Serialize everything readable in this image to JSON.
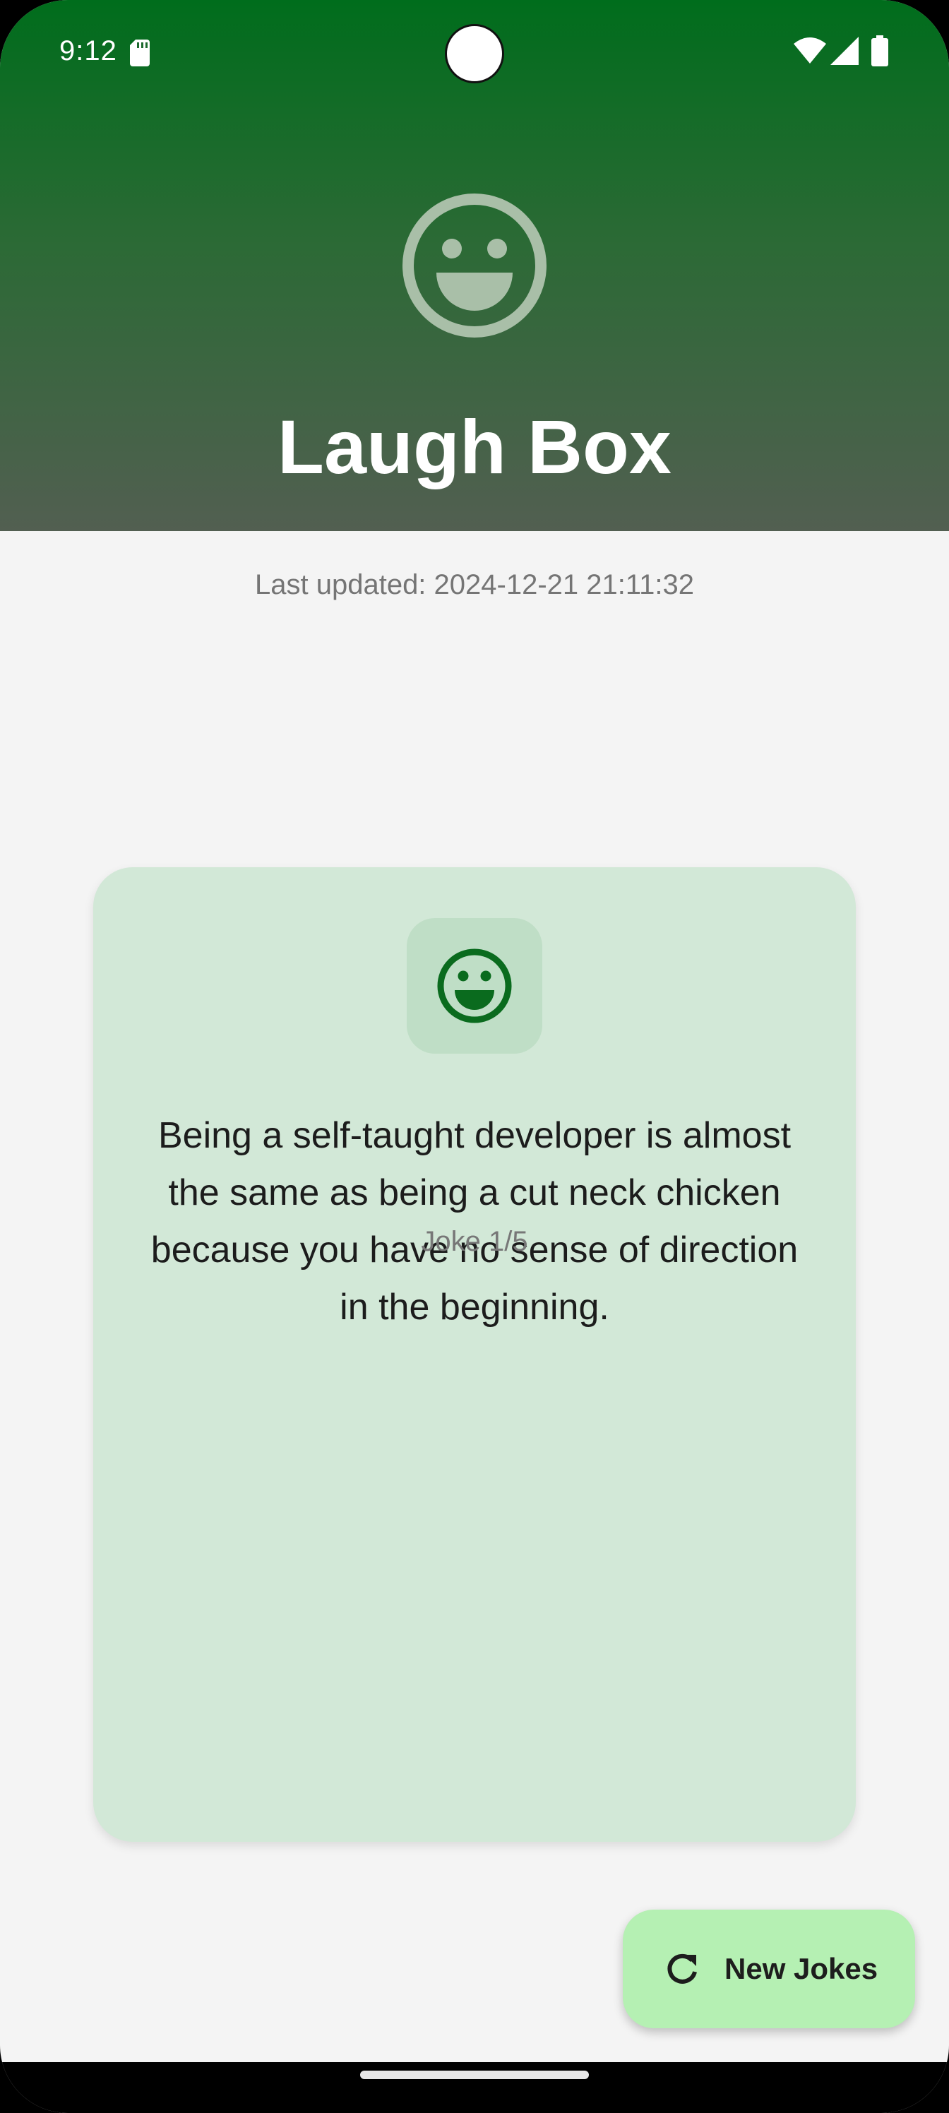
{
  "status_bar": {
    "time": "9:12",
    "icons": [
      "sd-card-icon",
      "wifi-icon",
      "signal-icon",
      "battery-icon"
    ]
  },
  "header": {
    "logo_icon": "smiley-face-icon",
    "title": "Laugh Box",
    "gradient_top_color": "#006d1c",
    "gradient_bottom_color": "#525f51"
  },
  "last_updated": "Last updated: 2024-12-21 21:11:32",
  "card": {
    "icon": "smiley-face-icon",
    "joke": "Being a self-taught developer is almost the same as being a cut neck chicken because you have no sense of direction in the beginning.",
    "counter": "Joke 1/5",
    "background_color": "#d2e8d7"
  },
  "fab": {
    "icon": "refresh-icon",
    "label": "New Jokes",
    "background_color": "#b5f0b3"
  }
}
